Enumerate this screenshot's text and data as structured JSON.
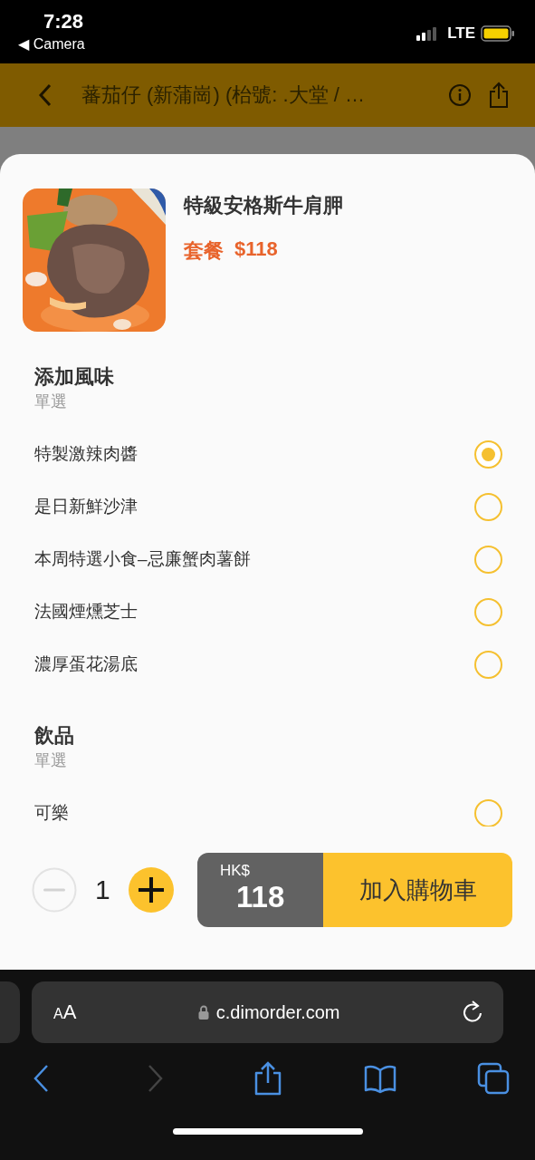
{
  "status_bar": {
    "time": "7:28",
    "back_label": "◀ Camera",
    "network": "LTE"
  },
  "header": {
    "title": "蕃茄仔 (新蒲崗) (枱號: .大堂 / …"
  },
  "item": {
    "name": "特級安格斯牛肩胛",
    "price_label": "套餐",
    "price": "$118"
  },
  "option_groups": [
    {
      "title": "添加風味",
      "rule": "單選",
      "options": [
        {
          "label": "特製激辣肉醬",
          "selected": true
        },
        {
          "label": "是日新鮮沙津",
          "selected": false
        },
        {
          "label": "本周特選小食–忌廉蟹肉薯餅",
          "selected": false
        },
        {
          "label": "法國煙燻芝士",
          "selected": false
        },
        {
          "label": "濃厚蛋花湯底",
          "selected": false
        }
      ]
    },
    {
      "title": "飲品",
      "rule": "單選",
      "options": [
        {
          "label": "可樂",
          "selected": false
        }
      ]
    }
  ],
  "quantity": "1",
  "cart": {
    "currency": "HK$",
    "total": "118",
    "label": "加入購物車"
  },
  "browser": {
    "text_size_label": "AA",
    "url": "c.dimorder.com",
    "nav": [
      {
        "kind": "back",
        "disabled": false
      },
      {
        "kind": "forward",
        "disabled": true
      },
      {
        "kind": "share",
        "disabled": false
      },
      {
        "kind": "bookmarks",
        "disabled": false
      },
      {
        "kind": "tabs",
        "disabled": false
      }
    ]
  }
}
